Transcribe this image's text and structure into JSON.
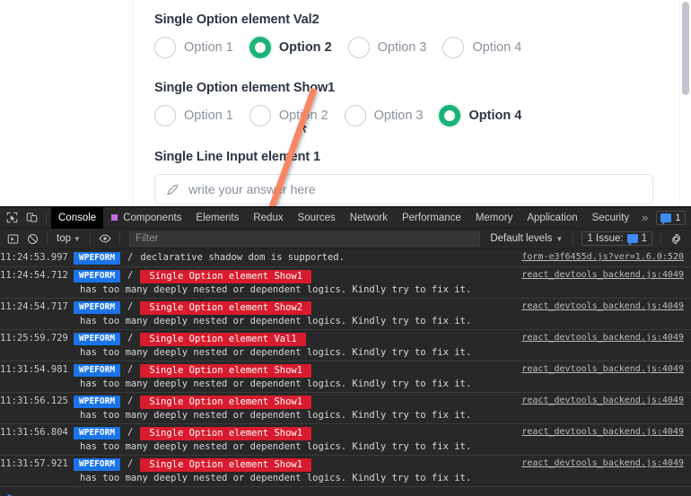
{
  "page": {
    "fields": [
      {
        "title": "Single Option element Val2",
        "type": "radio",
        "options": [
          {
            "label": "Option 1",
            "selected": false
          },
          {
            "label": "Option 2",
            "selected": true
          },
          {
            "label": "Option 3",
            "selected": false
          },
          {
            "label": "Option 4",
            "selected": false
          }
        ]
      },
      {
        "title": "Single Option element Show1",
        "type": "radio",
        "options": [
          {
            "label": "Option 1",
            "selected": false
          },
          {
            "label": "Option 2",
            "selected": false
          },
          {
            "label": "Option 3",
            "selected": false
          },
          {
            "label": "Option 4",
            "selected": true
          }
        ]
      },
      {
        "title": "Single Line Input element 1",
        "type": "text",
        "value": "",
        "placeholder": "write your answer here",
        "icon": "pen-icon"
      }
    ],
    "accent_color": "#1bb378",
    "annotation": {
      "type": "arrow",
      "color": "#f98564"
    }
  },
  "devtools": {
    "tabbar": {
      "left_icons": [
        "inspect-element-icon",
        "device-toolbar-icon"
      ],
      "tabs": [
        {
          "label": "Console",
          "active": true,
          "dot": false
        },
        {
          "label": "Components",
          "active": false,
          "dot": true
        },
        {
          "label": "Elements",
          "active": false,
          "dot": false
        },
        {
          "label": "Redux",
          "active": false,
          "dot": false
        },
        {
          "label": "Sources",
          "active": false,
          "dot": false
        },
        {
          "label": "Network",
          "active": false,
          "dot": false
        },
        {
          "label": "Performance",
          "active": false,
          "dot": false
        },
        {
          "label": "Memory",
          "active": false,
          "dot": false
        },
        {
          "label": "Application",
          "active": false,
          "dot": false
        },
        {
          "label": "Security",
          "active": false,
          "dot": false
        }
      ],
      "overflow_label": "»",
      "issue_count": "1",
      "right_icons": [
        "settings-gear-icon",
        "more-options-icon",
        "close-icon"
      ]
    },
    "filterbar": {
      "execute_icon": "execute-snippet-icon",
      "clear_icon": "clear-console-icon",
      "context": "top",
      "eye_icon": "live-expression-icon",
      "filter_value": "",
      "filter_placeholder": "Filter",
      "levels": "Default levels",
      "issues_label": "1 Issue:",
      "issues_count": "1",
      "settings_icon": "console-settings-icon"
    },
    "console": {
      "prompt": ">",
      "logs": [
        {
          "timestamp": "11:24:53.997",
          "tag": "WPEFORM",
          "separator": "/",
          "error_label": "",
          "message": "declarative shadow dom is supported.",
          "detail": "",
          "source": "form-e3f6455d.js?ver=1.6.0:520"
        },
        {
          "timestamp": "11:24:54.712",
          "tag": "WPEFORM",
          "separator": "/",
          "error_label": "Single Option element Show1",
          "message": "",
          "detail": "has too many deeply nested or dependent logics. Kindly try to fix it.",
          "source": "react_devtools_backend.js:4049"
        },
        {
          "timestamp": "11:24:54.717",
          "tag": "WPEFORM",
          "separator": "/",
          "error_label": "Single Option element Show2",
          "message": "",
          "detail": "has too many deeply nested or dependent logics. Kindly try to fix it.",
          "source": "react_devtools_backend.js:4049"
        },
        {
          "timestamp": "11:25:59.729",
          "tag": "WPEFORM",
          "separator": "/",
          "error_label": "Single Option element Val1",
          "message": "",
          "detail": "has too many deeply nested or dependent logics. Kindly try to fix it.",
          "source": "react_devtools_backend.js:4049"
        },
        {
          "timestamp": "11:31:54.981",
          "tag": "WPEFORM",
          "separator": "/",
          "error_label": "Single Option element Show1",
          "message": "",
          "detail": "has too many deeply nested or dependent logics. Kindly try to fix it.",
          "source": "react_devtools_backend.js:4049"
        },
        {
          "timestamp": "11:31:56.125",
          "tag": "WPEFORM",
          "separator": "/",
          "error_label": "Single Option element Show1",
          "message": "",
          "detail": "has too many deeply nested or dependent logics. Kindly try to fix it.",
          "source": "react_devtools_backend.js:4049"
        },
        {
          "timestamp": "11:31:56.804",
          "tag": "WPEFORM",
          "separator": "/",
          "error_label": "Single Option element Show1",
          "message": "",
          "detail": "has too many deeply nested or dependent logics. Kindly try to fix it.",
          "source": "react_devtools_backend.js:4049"
        },
        {
          "timestamp": "11:31:57.921",
          "tag": "WPEFORM",
          "separator": "/",
          "error_label": "Single Option element Show1",
          "message": "",
          "detail": "has too many deeply nested or dependent logics. Kindly try to fix it.",
          "source": "react_devtools_backend.js:4049"
        }
      ]
    }
  }
}
